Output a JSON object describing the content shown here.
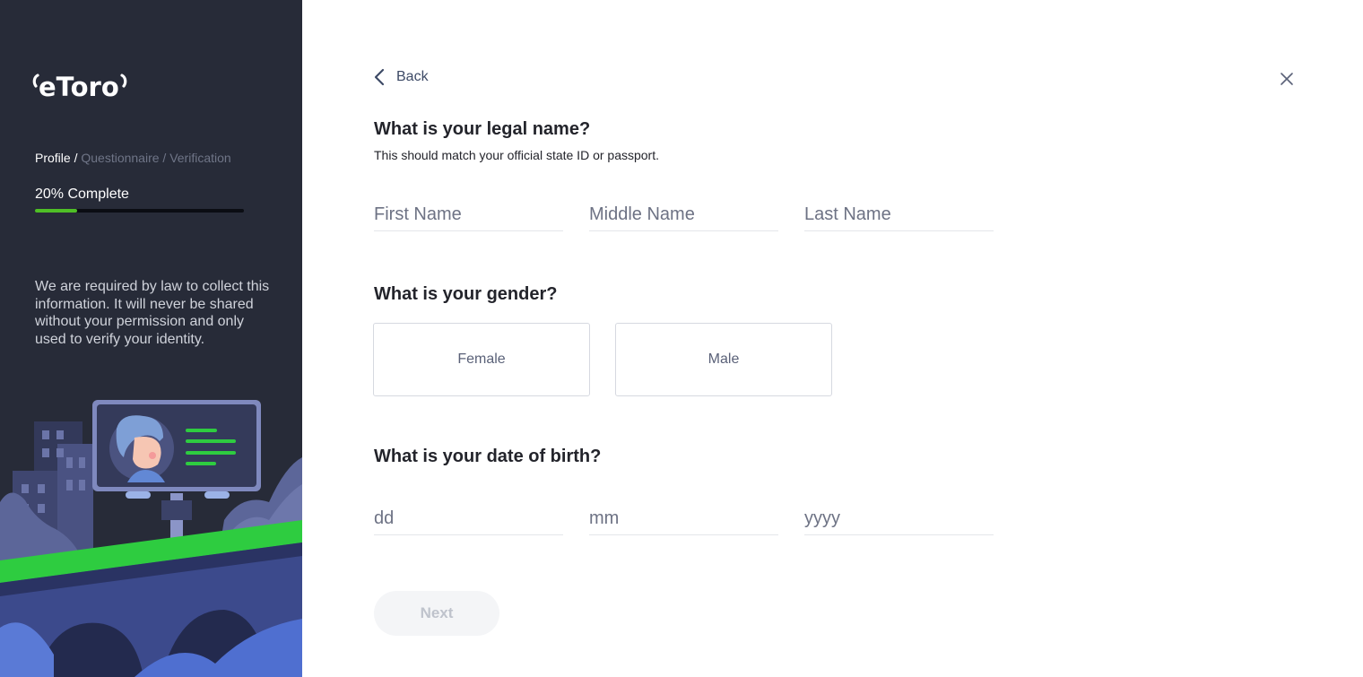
{
  "sidebar": {
    "logo_text": "eToro",
    "breadcrumb": {
      "active": "Profile",
      "separator": " / ",
      "rest": "Questionnaire / Verification"
    },
    "progress": {
      "percent_label": "20%",
      "label_suffix": " Complete",
      "fraction": 0.2
    },
    "legal_text": "We are required by law to collect this information. It will never be shared without your permission and only used to verify your identity."
  },
  "header": {
    "back_label": "Back",
    "close_icon": "close-icon"
  },
  "name_section": {
    "title": "What is your legal name?",
    "subtitle": "This should match your official state ID or passport.",
    "first_placeholder": "First Name",
    "middle_placeholder": "Middle Name",
    "last_placeholder": "Last Name"
  },
  "gender_section": {
    "title": "What is your gender?",
    "options": [
      "Female",
      "Male"
    ]
  },
  "dob_section": {
    "title": "What is your date of birth?",
    "day_placeholder": "dd",
    "month_placeholder": "mm",
    "year_placeholder": "yyyy"
  },
  "footer": {
    "next_label": "Next"
  },
  "colors": {
    "sidebar_bg": "#272b38",
    "accent_green": "#4fbf26",
    "text_dark": "#23242b"
  }
}
